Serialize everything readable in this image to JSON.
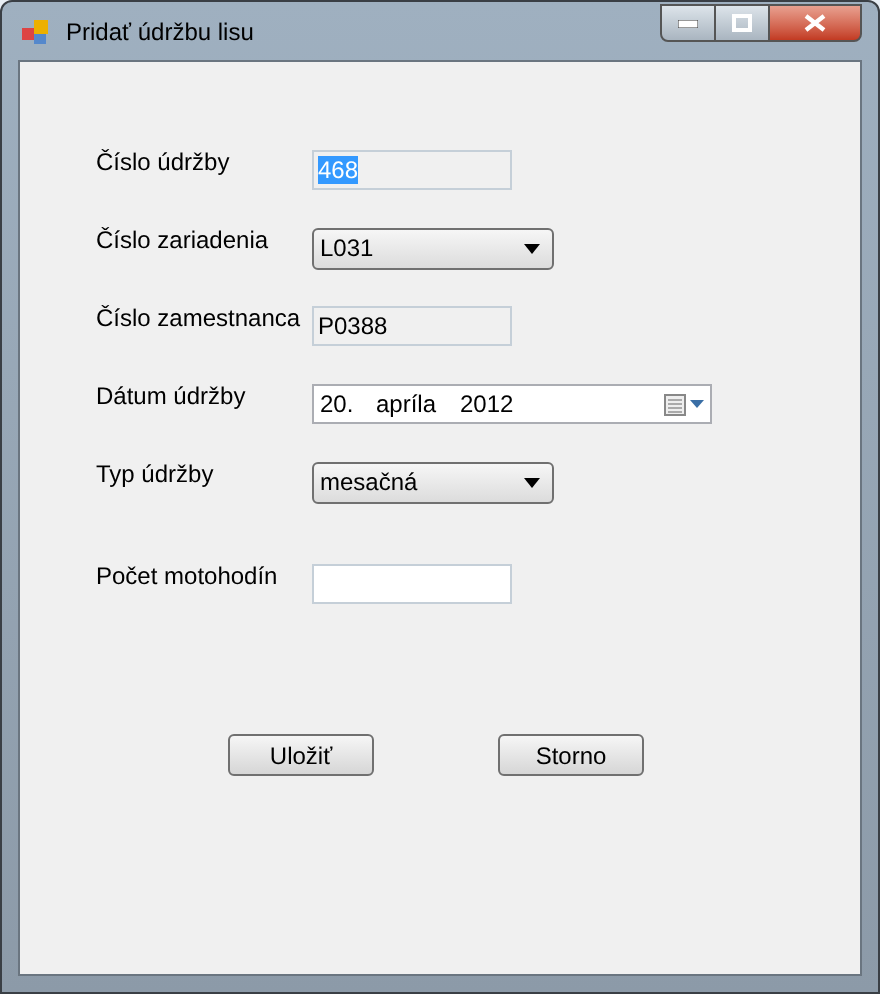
{
  "window": {
    "title": "Pridať údržbu lisu"
  },
  "fields": [
    {
      "kind": "text",
      "label": "Číslo údržby",
      "value": "468",
      "readonly": true,
      "text_selected": true
    },
    {
      "kind": "combo",
      "label": "Číslo zariadenia",
      "value": "L031"
    },
    {
      "kind": "text",
      "label": "Číslo zamestnanca",
      "value": "P0388",
      "readonly": true,
      "text_selected": false
    },
    {
      "kind": "date",
      "label": "Dátum údržby",
      "day": "20.",
      "month": "apríla",
      "year": "2012"
    },
    {
      "kind": "combo",
      "label": "Typ údržby",
      "value": "mesačná"
    },
    {
      "kind": "text",
      "label": "Počet motohodín",
      "readonly": false
    }
  ],
  "buttons": [
    "Uložiť",
    "Storno"
  ]
}
